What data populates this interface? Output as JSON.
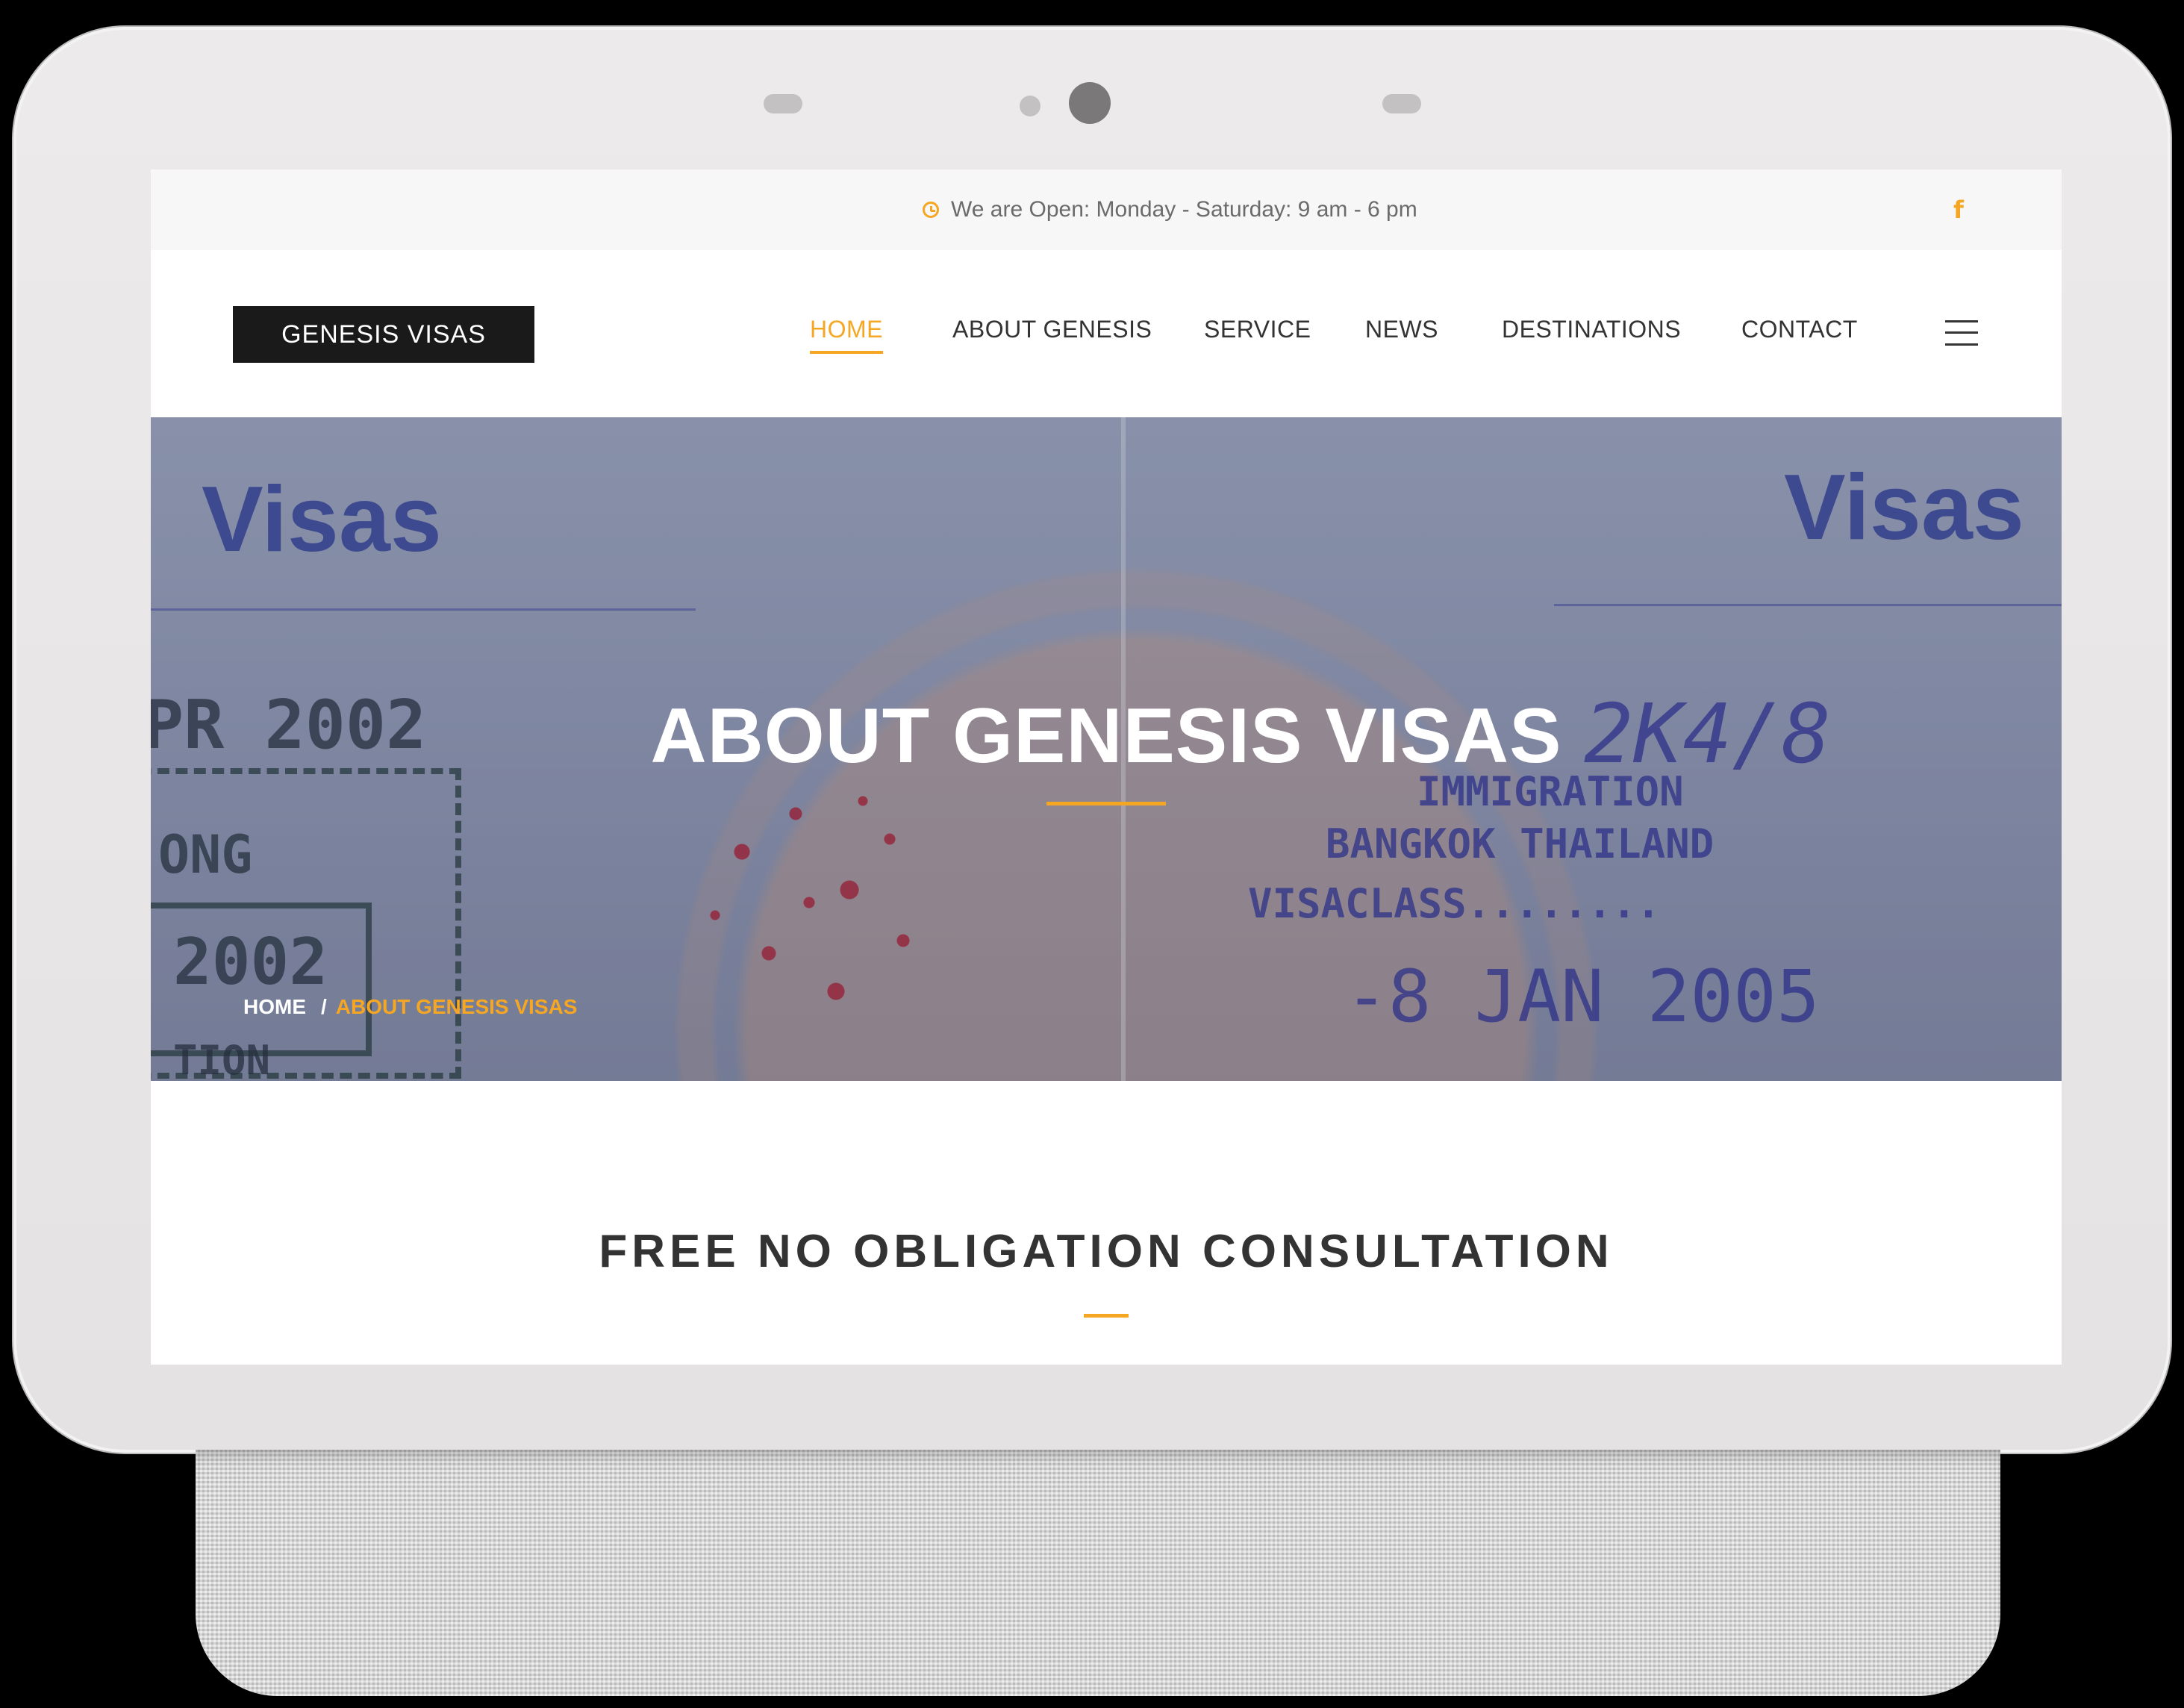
{
  "topbar": {
    "hours": "We are Open: Monday - Saturday: 9 am - 6 pm",
    "hours_icon": "clock-icon",
    "social_icon": "facebook-icon",
    "social_glyph": "f"
  },
  "header": {
    "logo_text": "GENESIS VISAS",
    "nav": [
      {
        "label": "HOME",
        "active": true
      },
      {
        "label": "ABOUT GENESIS"
      },
      {
        "label": "SERVICE"
      },
      {
        "label": "NEWS"
      },
      {
        "label": "DESTINATIONS"
      },
      {
        "label": "CONTACT"
      }
    ],
    "menu_icon": "hamburger-menu-icon"
  },
  "hero": {
    "title": "ABOUT GENESIS VISAS",
    "breadcrumb": {
      "home": "HOME",
      "separator": "/",
      "current": "ABOUT GENESIS VISAS"
    },
    "background": {
      "word_left": "Visas",
      "word_right": "Visas",
      "stamp_year_top": "PR 2002",
      "stamp_city": "ONG",
      "stamp_year_box": "2002",
      "stamp_bottom": "TION",
      "stamp_immigration": "IMMIGRATION",
      "stamp_location": "BANGKOK THAILAND",
      "stamp_class": "VISACLASS........",
      "stamp_date": "-8 JAN 2005",
      "stamp_handwriting": "2K4/8"
    }
  },
  "section": {
    "title": "FREE NO OBLIGATION CONSULTATION"
  },
  "colors": {
    "accent": "#f5a623",
    "logo_bg": "#1a1a1a",
    "text_dark": "#333333",
    "topbar_bg": "#f7f7f7"
  }
}
